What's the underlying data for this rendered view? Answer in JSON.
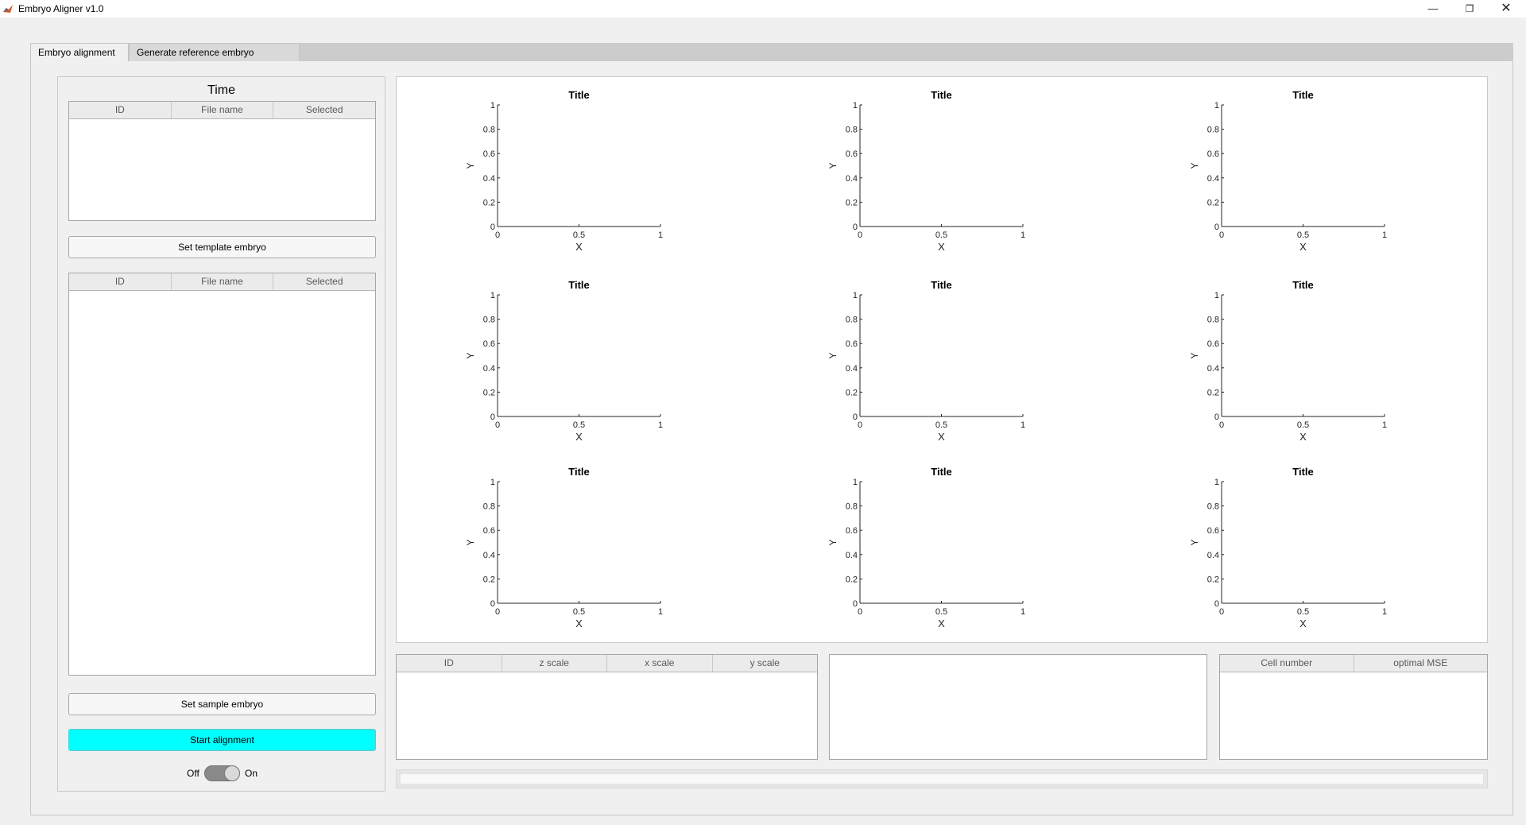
{
  "window": {
    "title": "Embryo Aligner v1.0",
    "minimize_glyph": "—",
    "maximize_glyph": "❐",
    "close_glyph": "✕"
  },
  "tabs": [
    {
      "label": "Embryo alignment",
      "active": true
    },
    {
      "label": "Generate reference embryo",
      "active": false
    }
  ],
  "left_panel": {
    "title": "Time",
    "template_table": {
      "columns": [
        "ID",
        "File name",
        "Selected"
      ],
      "rows": []
    },
    "set_template_button": "Set template embryo",
    "sample_table": {
      "columns": [
        "ID",
        "File name",
        "Selected"
      ],
      "rows": []
    },
    "set_sample_button": "Set sample embryo",
    "start_button": "Start alignment",
    "switch": {
      "off_label": "Off",
      "on_label": "On",
      "value": "Off"
    }
  },
  "plots": {
    "count": 9,
    "title": "Title",
    "xlabel": "X",
    "ylabel": "Y",
    "xticks": [
      "0",
      "0.5",
      "1"
    ],
    "yticks": [
      "0",
      "0.2",
      "0.4",
      "0.6",
      "0.8",
      "1"
    ]
  },
  "chart_data": [
    {
      "type": "line",
      "title": "Title",
      "xlabel": "X",
      "ylabel": "Y",
      "xlim": [
        0,
        1
      ],
      "ylim": [
        0,
        1
      ],
      "series": []
    },
    {
      "type": "line",
      "title": "Title",
      "xlabel": "X",
      "ylabel": "Y",
      "xlim": [
        0,
        1
      ],
      "ylim": [
        0,
        1
      ],
      "series": []
    },
    {
      "type": "line",
      "title": "Title",
      "xlabel": "X",
      "ylabel": "Y",
      "xlim": [
        0,
        1
      ],
      "ylim": [
        0,
        1
      ],
      "series": []
    },
    {
      "type": "line",
      "title": "Title",
      "xlabel": "X",
      "ylabel": "Y",
      "xlim": [
        0,
        1
      ],
      "ylim": [
        0,
        1
      ],
      "series": []
    },
    {
      "type": "line",
      "title": "Title",
      "xlabel": "X",
      "ylabel": "Y",
      "xlim": [
        0,
        1
      ],
      "ylim": [
        0,
        1
      ],
      "series": []
    },
    {
      "type": "line",
      "title": "Title",
      "xlabel": "X",
      "ylabel": "Y",
      "xlim": [
        0,
        1
      ],
      "ylim": [
        0,
        1
      ],
      "series": []
    },
    {
      "type": "line",
      "title": "Title",
      "xlabel": "X",
      "ylabel": "Y",
      "xlim": [
        0,
        1
      ],
      "ylim": [
        0,
        1
      ],
      "series": []
    },
    {
      "type": "line",
      "title": "Title",
      "xlabel": "X",
      "ylabel": "Y",
      "xlim": [
        0,
        1
      ],
      "ylim": [
        0,
        1
      ],
      "series": []
    },
    {
      "type": "line",
      "title": "Title",
      "xlabel": "X",
      "ylabel": "Y",
      "xlim": [
        0,
        1
      ],
      "ylim": [
        0,
        1
      ],
      "series": []
    }
  ],
  "scale_table": {
    "columns": [
      "ID",
      "z scale",
      "x scale",
      "y scale"
    ],
    "rows": []
  },
  "mse_table": {
    "columns": [
      "Cell number",
      "optimal MSE"
    ],
    "rows": []
  },
  "progress": {
    "value": 0
  },
  "colors": {
    "accent_button": "#00ffff",
    "window_bg": "#f0f0f0"
  }
}
